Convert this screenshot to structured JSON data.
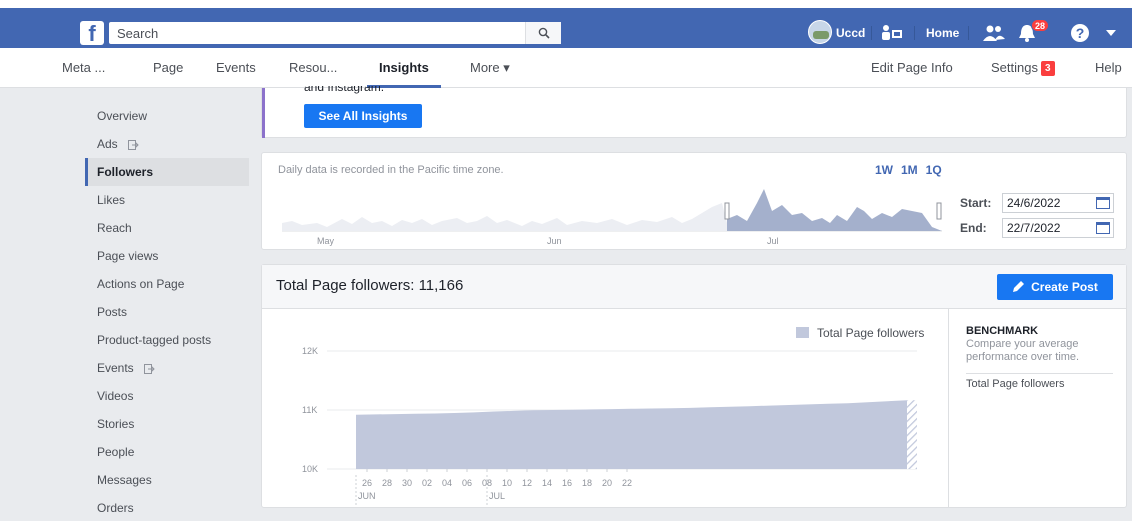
{
  "topbar": {
    "logo": "f",
    "search_placeholder": "Search",
    "user_name": "Uccd",
    "home_label": "Home",
    "notification_count": "28"
  },
  "nav": {
    "items": [
      "Meta ...",
      "Page",
      "Events",
      "Resou...",
      "Insights",
      "More ▾"
    ],
    "active": "Insights",
    "edit_page_info": "Edit Page Info",
    "settings_label": "Settings",
    "settings_badge": "3",
    "help_label": "Help"
  },
  "sidebar": {
    "items": [
      {
        "label": "Overview"
      },
      {
        "label": "Ads",
        "icon": "export-icon"
      },
      {
        "label": "Followers",
        "active": true
      },
      {
        "label": "Likes"
      },
      {
        "label": "Reach"
      },
      {
        "label": "Page views"
      },
      {
        "label": "Actions on Page"
      },
      {
        "label": "Posts"
      },
      {
        "label": "Product-tagged posts"
      },
      {
        "label": "Events",
        "icon": "export-icon"
      },
      {
        "label": "Videos"
      },
      {
        "label": "Stories"
      },
      {
        "label": "People"
      },
      {
        "label": "Messages"
      },
      {
        "label": "Orders"
      }
    ]
  },
  "insights_banner": {
    "cut_text": "and Instagram.",
    "button_label": "See All Insights"
  },
  "range": {
    "note": "Daily data is recorded in the Pacific time zone.",
    "presets": [
      "1W",
      "1M",
      "1Q"
    ],
    "start_label": "Start:",
    "start_value": "24/6/2022",
    "end_label": "End:",
    "end_value": "22/7/2022",
    "months": [
      "May",
      "Jun",
      "Jul"
    ]
  },
  "followers": {
    "title": "Total Page followers: 11,166",
    "create_post_label": "Create Post",
    "legend": "Total Page followers",
    "benchmark_title": "BENCHMARK",
    "benchmark_desc": "Compare your average performance over time.",
    "benchmark_link": "Total Page followers"
  },
  "colors": {
    "brand_blue": "#4267b2",
    "button_blue": "#1877f2",
    "area_fill": "#c1c8dc",
    "badge_red": "#fa3e3e"
  },
  "chart_data": {
    "type": "area",
    "title": "Total Page followers: 11,166",
    "legend": [
      "Total Page followers"
    ],
    "y_ticks": [
      "12K",
      "11K",
      "10K"
    ],
    "ylim": [
      10000,
      12000
    ],
    "x_ticks": [
      "26",
      "28",
      "30",
      "02",
      "04",
      "06",
      "08",
      "10",
      "12",
      "14",
      "16",
      "18",
      "20",
      "22"
    ],
    "x_month_labels": [
      "JUN",
      "JUL"
    ],
    "x": [
      "24/6",
      "25/6",
      "26/6",
      "27/6",
      "28/6",
      "29/6",
      "30/6",
      "1/7",
      "2/7",
      "3/7",
      "4/7",
      "5/7",
      "6/7",
      "7/7",
      "8/7",
      "9/7",
      "10/7",
      "11/7",
      "12/7",
      "13/7",
      "14/7",
      "15/7",
      "16/7",
      "17/7",
      "18/7",
      "19/7",
      "20/7",
      "21/7",
      "22/7"
    ],
    "series": [
      {
        "name": "Total Page followers",
        "values": [
          10920,
          10925,
          10930,
          10935,
          10940,
          10950,
          10960,
          10975,
          10985,
          10995,
          11000,
          11005,
          11010,
          11015,
          11020,
          11025,
          11030,
          11035,
          11045,
          11055,
          11065,
          11075,
          11085,
          11095,
          11105,
          11115,
          11130,
          11150,
          11166
        ]
      }
    ],
    "grid": true,
    "legend_position": "top-right"
  }
}
